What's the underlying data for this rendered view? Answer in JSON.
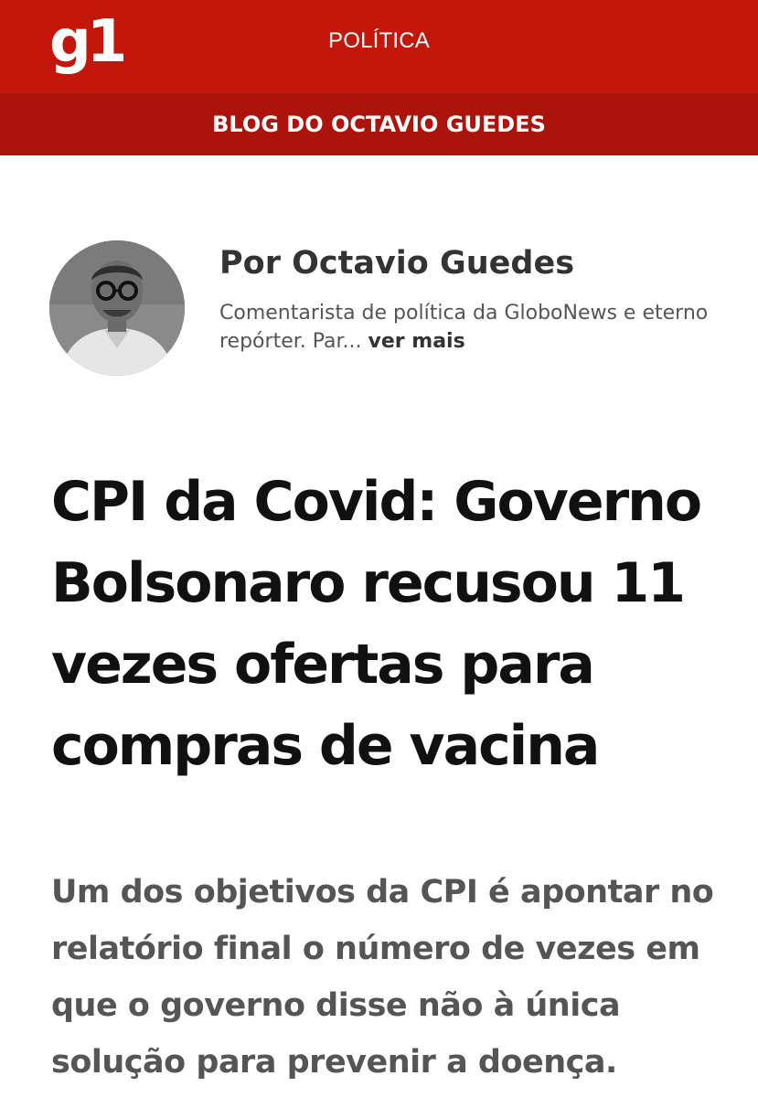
{
  "header": {
    "logo": "g1",
    "section": "POLÍTICA",
    "blog": "BLOG DO OCTAVIO GUEDES",
    "brand_color": "#c4170c",
    "blog_bar_color": "#ab130b"
  },
  "author": {
    "name": "Por Octavio Guedes",
    "bio": "Comentarista de política da GloboNews e eterno repórter. Par...",
    "see_more": "ver mais"
  },
  "article": {
    "title": "CPI da Covid: Governo Bolsonaro recusou 11 vezes ofertas para compras de vacina",
    "subtitle": "Um dos objetivos da CPI é apontar no relatório final o número de vezes em que o governo disse não à única solução para prevenir a doença."
  }
}
